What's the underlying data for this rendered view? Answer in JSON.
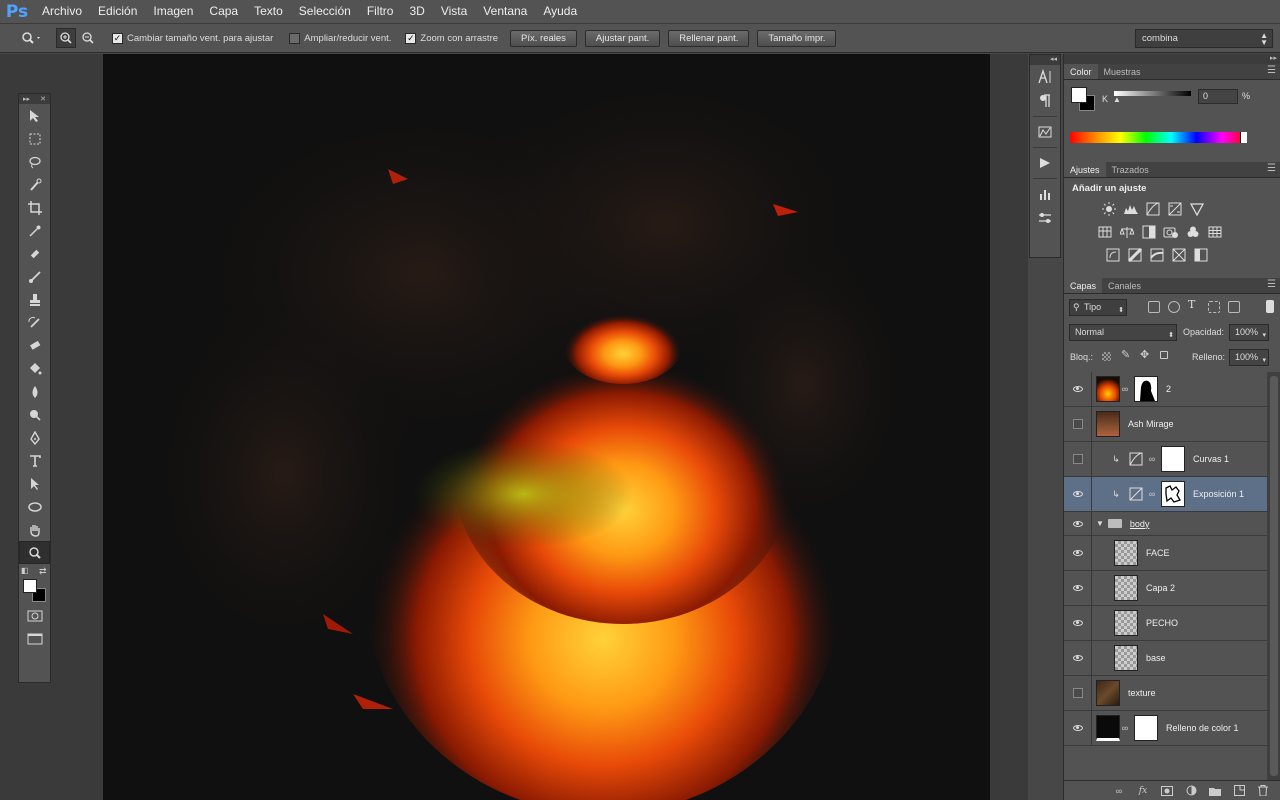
{
  "app": {
    "logo": "Ps"
  },
  "menu": [
    "Archivo",
    "Edición",
    "Imagen",
    "Capa",
    "Texto",
    "Selección",
    "Filtro",
    "3D",
    "Vista",
    "Ventana",
    "Ayuda"
  ],
  "options": {
    "resize_windows": "Cambiar tamaño vent. para ajustar",
    "zoom_all": "Ampliar/reducir vent.",
    "scrubby_zoom": "Zoom con arrastre",
    "btn_actual": "Píx. reales",
    "btn_fit": "Ajustar pant.",
    "btn_fill": "Rellenar pant.",
    "btn_print": "Tamaño impr.",
    "workspace": "combina"
  },
  "color_panel": {
    "tab_color": "Color",
    "tab_swatches": "Muestras",
    "k_label": "K",
    "k_value": "0",
    "k_unit": "%"
  },
  "adjust_panel": {
    "tab_adjust": "Ajustes",
    "tab_paths": "Trazados",
    "title": "Añadir un ajuste"
  },
  "layers_panel": {
    "tab_layers": "Capas",
    "tab_channels": "Canales",
    "kind": "Tipo",
    "blend_mode": "Normal",
    "opacity_label": "Opacidad:",
    "opacity": "100%",
    "lock_label": "Bloq.:",
    "fill_label": "Relleno:",
    "fill": "100%",
    "layers": [
      {
        "name": "2",
        "visible": true
      },
      {
        "name": "Ash Mirage",
        "visible": false
      },
      {
        "name": "Curvas 1",
        "visible": false
      },
      {
        "name": "Exposición 1",
        "visible": true,
        "selected": true
      },
      {
        "name": "body",
        "visible": true,
        "group": true
      },
      {
        "name": "FACE",
        "visible": true
      },
      {
        "name": "Capa 2",
        "visible": true
      },
      {
        "name": "PECHO",
        "visible": true
      },
      {
        "name": "base",
        "visible": true
      },
      {
        "name": "texture",
        "visible": false
      },
      {
        "name": "Relleno de color 1",
        "visible": true
      }
    ]
  },
  "colors": {
    "ui_bg": "#535353",
    "canvas_bg": "#101010",
    "selection": "#5e6f88",
    "accent": "#4da3ff"
  }
}
